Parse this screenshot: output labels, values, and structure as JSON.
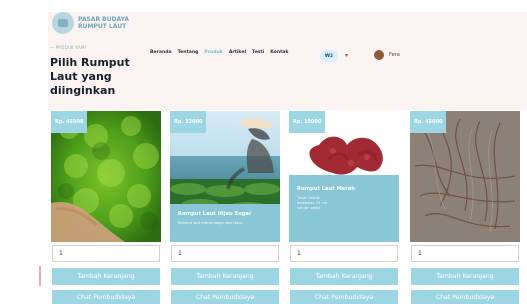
{
  "brand": {
    "line1": "PASAR BUDAYA",
    "line2": "RUMPUT LAUT"
  },
  "nav": {
    "items": [
      "Beranda",
      "Tentang",
      "Produk",
      "Artikel",
      "Testi",
      "Kontak"
    ],
    "active_index": 2,
    "pill": "₩2",
    "user_name": "Fera"
  },
  "hero": {
    "kicker": "— PRODUK KAMI",
    "title": "Pilih Rumput Laut yang diinginkan"
  },
  "products": [
    {
      "price": "Rp. 45500",
      "overlay_name": "",
      "overlay_desc": "",
      "qty": "1",
      "add_label": "Tambah Keranjang",
      "chat_label": "Chat Pembudidaya"
    },
    {
      "price": "Rp. 32000",
      "overlay_name": "Rumput Laut Hijau Segar",
      "overlay_desc": "Rumput laut merah segar dan takut",
      "qty": "1",
      "add_label": "Tambah Keranjang",
      "chat_label": "Chat Pembudidaya"
    },
    {
      "price": "Rp. 15000",
      "overlay_name": "Rumput Laut Merah",
      "overlay_desc": "Tanah merah\nketebalan 25 cm\nsatuan sebal",
      "qty": "1",
      "add_label": "Tambah Keranjang",
      "chat_label": "Chat Pembudidaya"
    },
    {
      "price": "Rp. 45000",
      "overlay_name": "",
      "overlay_desc": "",
      "qty": "1",
      "add_label": "Tambah Keranjang",
      "chat_label": "Chat Pembudidaya"
    }
  ],
  "colors": {
    "accent": "#9bd6e2",
    "header_bg": "#fbf3f1",
    "overlay": "#89c6d6"
  }
}
